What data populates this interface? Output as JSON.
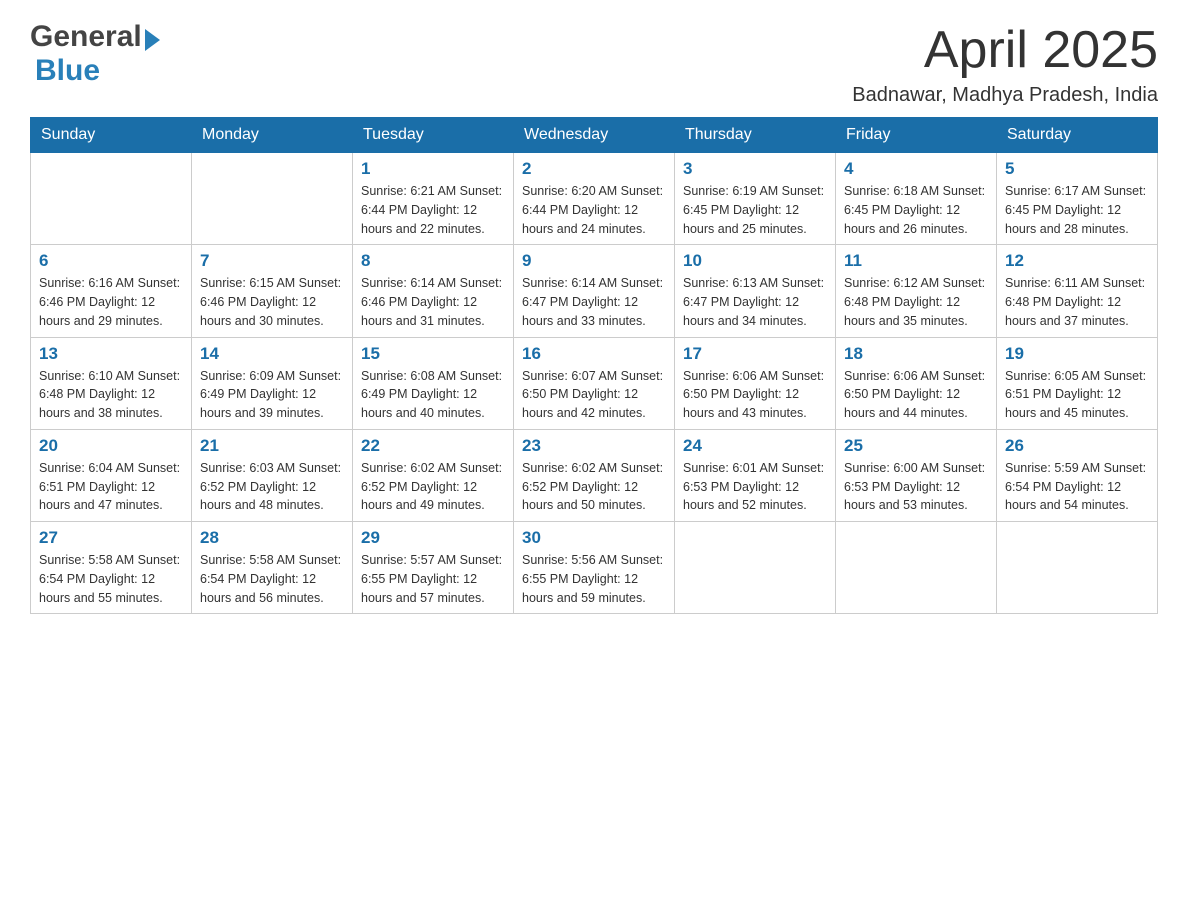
{
  "logo": {
    "general": "General",
    "blue": "Blue"
  },
  "header": {
    "month": "April 2025",
    "location": "Badnawar, Madhya Pradesh, India"
  },
  "weekdays": [
    "Sunday",
    "Monday",
    "Tuesday",
    "Wednesday",
    "Thursday",
    "Friday",
    "Saturday"
  ],
  "weeks": [
    [
      {
        "day": "",
        "info": ""
      },
      {
        "day": "",
        "info": ""
      },
      {
        "day": "1",
        "info": "Sunrise: 6:21 AM\nSunset: 6:44 PM\nDaylight: 12 hours\nand 22 minutes."
      },
      {
        "day": "2",
        "info": "Sunrise: 6:20 AM\nSunset: 6:44 PM\nDaylight: 12 hours\nand 24 minutes."
      },
      {
        "day": "3",
        "info": "Sunrise: 6:19 AM\nSunset: 6:45 PM\nDaylight: 12 hours\nand 25 minutes."
      },
      {
        "day": "4",
        "info": "Sunrise: 6:18 AM\nSunset: 6:45 PM\nDaylight: 12 hours\nand 26 minutes."
      },
      {
        "day": "5",
        "info": "Sunrise: 6:17 AM\nSunset: 6:45 PM\nDaylight: 12 hours\nand 28 minutes."
      }
    ],
    [
      {
        "day": "6",
        "info": "Sunrise: 6:16 AM\nSunset: 6:46 PM\nDaylight: 12 hours\nand 29 minutes."
      },
      {
        "day": "7",
        "info": "Sunrise: 6:15 AM\nSunset: 6:46 PM\nDaylight: 12 hours\nand 30 minutes."
      },
      {
        "day": "8",
        "info": "Sunrise: 6:14 AM\nSunset: 6:46 PM\nDaylight: 12 hours\nand 31 minutes."
      },
      {
        "day": "9",
        "info": "Sunrise: 6:14 AM\nSunset: 6:47 PM\nDaylight: 12 hours\nand 33 minutes."
      },
      {
        "day": "10",
        "info": "Sunrise: 6:13 AM\nSunset: 6:47 PM\nDaylight: 12 hours\nand 34 minutes."
      },
      {
        "day": "11",
        "info": "Sunrise: 6:12 AM\nSunset: 6:48 PM\nDaylight: 12 hours\nand 35 minutes."
      },
      {
        "day": "12",
        "info": "Sunrise: 6:11 AM\nSunset: 6:48 PM\nDaylight: 12 hours\nand 37 minutes."
      }
    ],
    [
      {
        "day": "13",
        "info": "Sunrise: 6:10 AM\nSunset: 6:48 PM\nDaylight: 12 hours\nand 38 minutes."
      },
      {
        "day": "14",
        "info": "Sunrise: 6:09 AM\nSunset: 6:49 PM\nDaylight: 12 hours\nand 39 minutes."
      },
      {
        "day": "15",
        "info": "Sunrise: 6:08 AM\nSunset: 6:49 PM\nDaylight: 12 hours\nand 40 minutes."
      },
      {
        "day": "16",
        "info": "Sunrise: 6:07 AM\nSunset: 6:50 PM\nDaylight: 12 hours\nand 42 minutes."
      },
      {
        "day": "17",
        "info": "Sunrise: 6:06 AM\nSunset: 6:50 PM\nDaylight: 12 hours\nand 43 minutes."
      },
      {
        "day": "18",
        "info": "Sunrise: 6:06 AM\nSunset: 6:50 PM\nDaylight: 12 hours\nand 44 minutes."
      },
      {
        "day": "19",
        "info": "Sunrise: 6:05 AM\nSunset: 6:51 PM\nDaylight: 12 hours\nand 45 minutes."
      }
    ],
    [
      {
        "day": "20",
        "info": "Sunrise: 6:04 AM\nSunset: 6:51 PM\nDaylight: 12 hours\nand 47 minutes."
      },
      {
        "day": "21",
        "info": "Sunrise: 6:03 AM\nSunset: 6:52 PM\nDaylight: 12 hours\nand 48 minutes."
      },
      {
        "day": "22",
        "info": "Sunrise: 6:02 AM\nSunset: 6:52 PM\nDaylight: 12 hours\nand 49 minutes."
      },
      {
        "day": "23",
        "info": "Sunrise: 6:02 AM\nSunset: 6:52 PM\nDaylight: 12 hours\nand 50 minutes."
      },
      {
        "day": "24",
        "info": "Sunrise: 6:01 AM\nSunset: 6:53 PM\nDaylight: 12 hours\nand 52 minutes."
      },
      {
        "day": "25",
        "info": "Sunrise: 6:00 AM\nSunset: 6:53 PM\nDaylight: 12 hours\nand 53 minutes."
      },
      {
        "day": "26",
        "info": "Sunrise: 5:59 AM\nSunset: 6:54 PM\nDaylight: 12 hours\nand 54 minutes."
      }
    ],
    [
      {
        "day": "27",
        "info": "Sunrise: 5:58 AM\nSunset: 6:54 PM\nDaylight: 12 hours\nand 55 minutes."
      },
      {
        "day": "28",
        "info": "Sunrise: 5:58 AM\nSunset: 6:54 PM\nDaylight: 12 hours\nand 56 minutes."
      },
      {
        "day": "29",
        "info": "Sunrise: 5:57 AM\nSunset: 6:55 PM\nDaylight: 12 hours\nand 57 minutes."
      },
      {
        "day": "30",
        "info": "Sunrise: 5:56 AM\nSunset: 6:55 PM\nDaylight: 12 hours\nand 59 minutes."
      },
      {
        "day": "",
        "info": ""
      },
      {
        "day": "",
        "info": ""
      },
      {
        "day": "",
        "info": ""
      }
    ]
  ]
}
